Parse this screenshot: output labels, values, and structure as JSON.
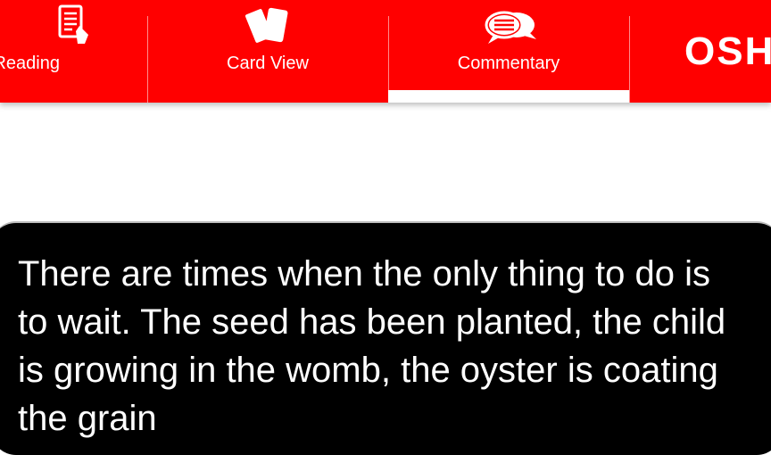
{
  "tabs": {
    "reading": {
      "label": "Reading",
      "icon": "reading-icon"
    },
    "card_view": {
      "label": "Card View",
      "icon": "cards-icon"
    },
    "commentary": {
      "label": "Commentary",
      "icon": "chat-bubbles-icon",
      "selected": true
    },
    "brand": {
      "label": "OSH"
    }
  },
  "card": {
    "text": "There are times when the only thing to do is to wait. The seed has been planted, the child is growing in the womb, the oyster is coating the grain"
  },
  "colors": {
    "accent": "#ff0000",
    "card_bg": "#000000",
    "text": "#ffffff"
  }
}
